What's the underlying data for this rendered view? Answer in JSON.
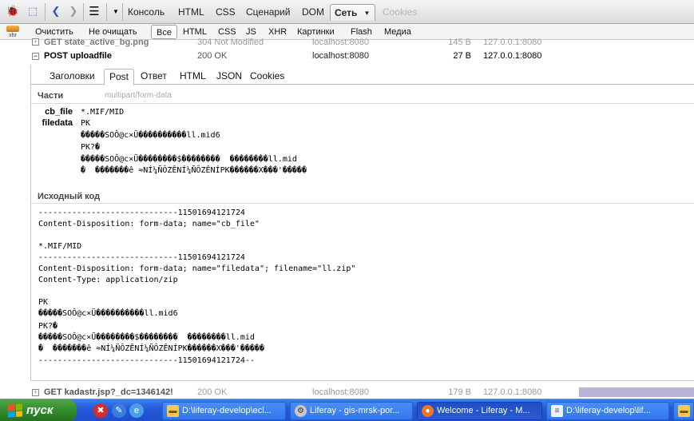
{
  "toolbar": {
    "panel_tabs": [
      "Консоль",
      "HTML",
      "CSS",
      "Сценарий",
      "DOM",
      "Сеть",
      "Cookies"
    ],
    "active_tab": "Сеть",
    "dropdown_arrow": "▼"
  },
  "filterbar": {
    "xhr_label": "xhr",
    "buttons": [
      "Очистить",
      "Не очищать",
      "Все",
      "HTML",
      "CSS",
      "JS",
      "XHR",
      "Картинки",
      "Flash",
      "Медиа"
    ],
    "active": "Все"
  },
  "requests": [
    {
      "toggle": "+",
      "url": "GET state_active_bg.png",
      "status": "304 Not Modified",
      "domain": "localhost:8080",
      "size": "145 B",
      "ip": "127.0.0.1:8080"
    },
    {
      "toggle": "−",
      "url": "POST uploadfile",
      "status": "200 OK",
      "domain": "localhost:8080",
      "size": "27 B",
      "ip": "127.0.0.1:8080"
    },
    {
      "toggle": "+",
      "url": "GET kadastr.jsp?_dc=1346142!",
      "status": "200 OK",
      "domain": "localhost:8080",
      "size": "179 B",
      "ip": "127.0.0.1:8080"
    }
  ],
  "details": {
    "tabs": [
      "Заголовки",
      "Post",
      "Ответ",
      "HTML",
      "JSON",
      "Cookies"
    ],
    "active_tab": "Post",
    "parts_title": "Части",
    "parts_type": "multipart/form-data",
    "parts": [
      {
        "name": "cb_file",
        "lines": [
          "*.MIF/MID"
        ]
      },
      {
        "name": "filedata",
        "lines": [
          "PK",
          "�����SOÔ@c×Ü����������ll.mid6",
          "PK?�",
          "�����SOÔ@c×Ü��������$��������  ��������ll.mid",
          "�  �������ê ≈NÍ¼ÑÔZÊNÍ¼ÑÔZÊNÍPK������X���'�����"
        ]
      }
    ],
    "source_title": "Исходный код",
    "source_lines": [
      "-----------------------------11501694121724",
      "Content-Disposition: form-data; name=\"cb_file\"",
      "",
      "*.MIF/MID",
      "-----------------------------11501694121724",
      "Content-Disposition: form-data; name=\"filedata\"; filename=\"ll.zip\"",
      "Content-Type: application/zip",
      "",
      "PK",
      "�����SOÔ@c×Ü����������ll.mid6",
      "PK?�",
      "�����SOÔ@c×Ü��������$��������  ��������ll.mid",
      "�  �������ê ≈NÍ¼ÑÔZÊNÍ¼ÑÔZÊNÍPK������X���'�����",
      "-----------------------------11501694121724--"
    ]
  },
  "taskbar": {
    "start_label": "пуск",
    "tasks": [
      {
        "label": "D:\\liferay-develop\\ecl...",
        "icon": "folder-icon",
        "active": false
      },
      {
        "label": "Liferay - gis-mrsk-por...",
        "icon": "gear-icon",
        "active": false
      },
      {
        "label": "Welcome - Liferay - M...",
        "icon": "firefox-icon",
        "active": true
      },
      {
        "label": "D:\\liferay-develop\\lif...",
        "icon": "notepad-icon",
        "active": false
      }
    ]
  },
  "colors": {
    "taskbar": "#2457d7",
    "start": "#2f8a29",
    "active_task": "#1f4ec7"
  }
}
